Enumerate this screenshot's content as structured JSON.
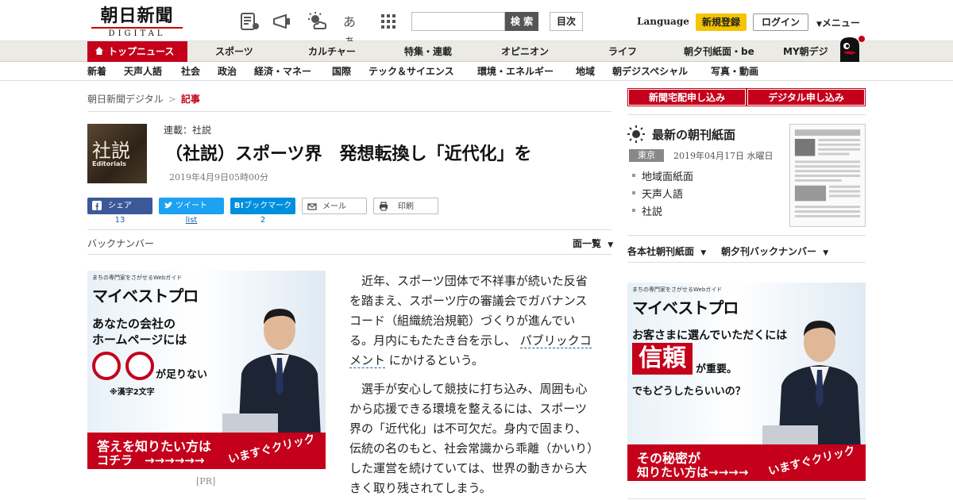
{
  "header": {
    "logo_jp": "朝日新聞",
    "logo_en": "DIGITAL",
    "font_size_label": "あぁ",
    "search_button": "検 索",
    "index_button": "目次",
    "language": "Language",
    "register": "新規登録",
    "login": "ログイン",
    "menu": "メニュー"
  },
  "nav": {
    "items": [
      "トップニュース",
      "スポーツ",
      "カルチャー",
      "特集・連載",
      "オピニオン",
      "ライフ",
      "朝夕刊紙面・be",
      "MY朝デジ"
    ]
  },
  "subnav": {
    "items": [
      "新着",
      "天声人語",
      "社会",
      "政治",
      "経済・マネー",
      "国際",
      "テック＆サイエンス",
      "環境・エネルギー",
      "地域",
      "朝デジスペシャル",
      "写真・動画"
    ]
  },
  "breadcrumb": {
    "home": "朝日新聞デジタル",
    "sep": ">",
    "current": "記事"
  },
  "article": {
    "image_kanji": "社説",
    "image_en": "Editorials",
    "series": "連載：社説",
    "headline": "（社説）スポーツ界　発想転換し「近代化」を",
    "date": "2019年4月9日05時00分",
    "share": {
      "facebook": "シェア",
      "facebook_count": "13",
      "twitter": "ツイート",
      "twitter_count": "list",
      "hatena": "ブックマーク",
      "hatena_count": "2",
      "mail": "メール",
      "print": "印刷"
    },
    "backnumber": "バックナンバー",
    "page_list": "面一覧",
    "paragraph1_a": "近年、スポーツ団体で不祥事が続いた反省を踏まえ、スポーツ庁の審議会でガバナンスコード（組織統治規範）づくりが進んでいる。月内にもたたき台を示し、",
    "paragraph1_link": "パブリックコメント",
    "paragraph1_b": "にかけるという。",
    "paragraph2": "選手が安心して競技に打ち込み、周囲も心から応援できる環境を整えるには、スポーツ界の「近代化」は不可欠だ。身内で固まり、伝統の名のもと、社会常識から乖離（かいり）した運営を続けていては、世界の動きから大きく取り残されてしまう。"
  },
  "ad_left": {
    "tag": "まちの専門家をさがせるWebガイド",
    "brand": "マイベストプロ",
    "line1": "あなたの会社の",
    "line2": "ホームページには",
    "short": "が足りない",
    "note": "※漢字2文字",
    "band1": "答えを知りたい方は",
    "band2": "コチラ　→→→→→→",
    "click": "いますぐクリック",
    "pr": "[PR]"
  },
  "ad_right": {
    "tag": "まちの専門家をさがせるWebガイド",
    "brand": "マイベストプロ",
    "line1": "お客さまに選んでいただくには",
    "trust": "信頼",
    "line2": "が重要。",
    "line3": "でもどうしたらいいの？",
    "band1": "その秘密が",
    "band2": "知りたい方は→→→→",
    "click": "いますぐクリック"
  },
  "sidebar": {
    "sub_home": "新聞宅配申し込み",
    "sub_digital": "デジタル申し込み",
    "paper_title": "最新の朝刊紙面",
    "region": "東京",
    "paper_date": "2019年04月17日 水曜日",
    "links": [
      "地域面紙面",
      "天声人語",
      "社説"
    ],
    "edition_menu": "各本社朝刊紙面",
    "back_menu": "朝夕刊バックナンバー"
  },
  "colors": {
    "brand_red": "#c4001b",
    "facebook": "#3b5998",
    "twitter": "#1da1f2",
    "hatena": "#008fde",
    "register_yellow": "#f5c400"
  },
  "icons": [
    "paper-icon",
    "megaphone-icon",
    "weather-icon",
    "grid-icon",
    "home-icon",
    "sun-icon",
    "mail-icon",
    "print-icon"
  ]
}
